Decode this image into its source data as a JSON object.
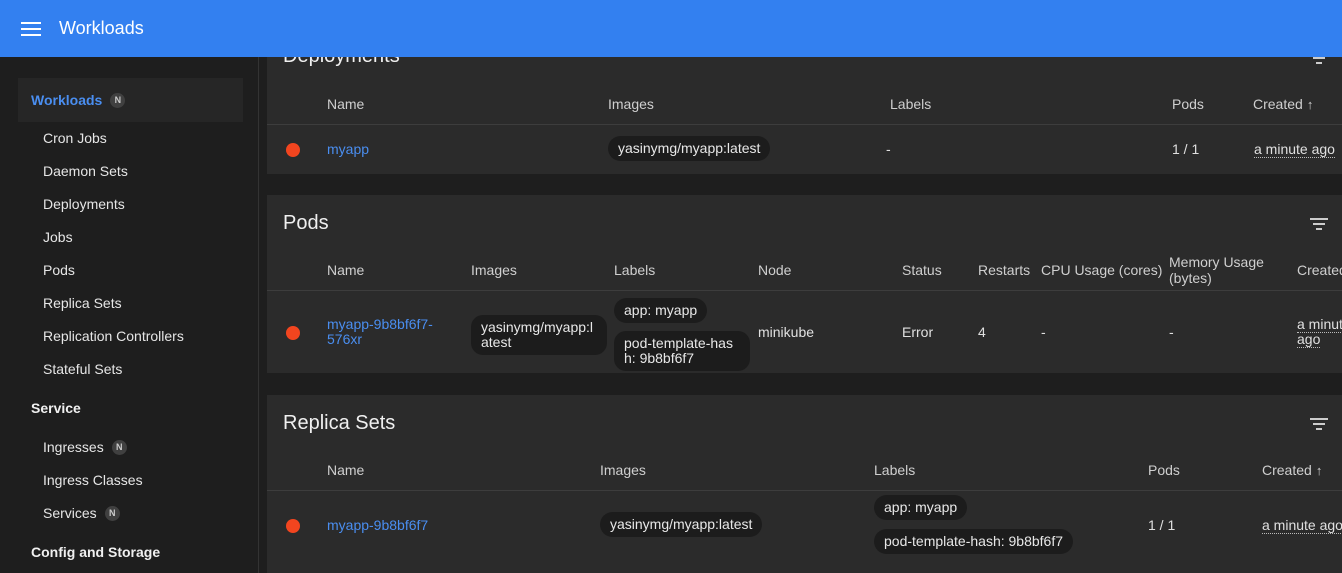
{
  "topbar": {
    "title": "Workloads"
  },
  "sidebar": {
    "group": {
      "label": "Workloads",
      "badge": "N"
    },
    "workload_items": [
      "Cron Jobs",
      "Daemon Sets",
      "Deployments",
      "Jobs",
      "Pods",
      "Replica Sets",
      "Replication Controllers",
      "Stateful Sets"
    ],
    "service_section": "Service",
    "service_items": [
      {
        "label": "Ingresses",
        "badge": "N"
      },
      {
        "label": "Ingress Classes",
        "badge": ""
      },
      {
        "label": "Services",
        "badge": "N"
      }
    ],
    "config_section": "Config and Storage"
  },
  "deployments": {
    "title": "Deployments",
    "headers": {
      "name": "Name",
      "images": "Images",
      "labels": "Labels",
      "pods": "Pods",
      "created": "Created"
    },
    "row": {
      "name": "myapp",
      "image": "yasinymg/myapp:latest",
      "labels": "-",
      "pods": "1 / 1",
      "created": "a minute ago"
    }
  },
  "pods": {
    "title": "Pods",
    "headers": {
      "name": "Name",
      "images": "Images",
      "labels": "Labels",
      "node": "Node",
      "status": "Status",
      "restarts": "Restarts",
      "cpu": "CPU Usage (cores)",
      "memory": "Memory Usage (bytes)",
      "created": "Created"
    },
    "row": {
      "name": "myapp-9b8bf6f7-576xr",
      "image": "yasinymg/myapp:latest",
      "label1": "app: myapp",
      "label2": "pod-template-hash: 9b8bf6f7",
      "node": "minikube",
      "status": "Error",
      "restarts": "4",
      "cpu": "-",
      "memory": "-",
      "created": "a minute ago"
    }
  },
  "replicasets": {
    "title": "Replica Sets",
    "headers": {
      "name": "Name",
      "images": "Images",
      "labels": "Labels",
      "pods": "Pods",
      "created": "Created"
    },
    "row": {
      "name": "myapp-9b8bf6f7",
      "image": "yasinymg/myapp:latest",
      "label1": "app: myapp",
      "label2": "pod-template-hash: 9b8bf6f7",
      "pods": "1 / 1",
      "created": "a minute ago"
    }
  },
  "colors": {
    "topbar": "#3380f0",
    "link": "#4a8ef0",
    "status_error": "#f2451f"
  },
  "icons": {
    "menu": "menu-icon",
    "filter": "filter-icon",
    "sort": "arrow-up-icon"
  }
}
